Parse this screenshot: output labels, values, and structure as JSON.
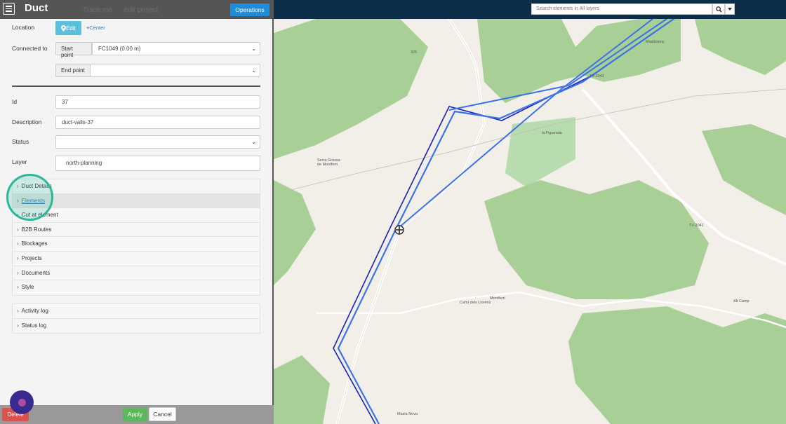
{
  "panel": {
    "title": "Duct",
    "ghost_tabs": [
      "Trace mo",
      "edit project"
    ],
    "operations_label": "Operations",
    "location_label": "Location",
    "edit_label": "Edit",
    "center_label": "Center",
    "connected_label": "Connected to",
    "start_point_label": "Start point",
    "start_point_value": "FC1049 (0.00 m)",
    "end_point_label": "End point",
    "end_point_value": "",
    "id_label": "Id",
    "id_value": "37",
    "description_label": "Description",
    "description_value": "duct-valls-37",
    "status_label": "Status",
    "status_value": "",
    "layer_label": "Layer",
    "layer_value": "north-planning",
    "sections": [
      "Duct Details",
      "Elements",
      "Cut at element",
      "B2B Routes",
      "Blockages",
      "Projects",
      "Documents",
      "Style"
    ],
    "logs": [
      "Activity log",
      "Status log"
    ],
    "delete_label": "Delete",
    "apply_label": "Apply",
    "cancel_label": "Cancel"
  },
  "search": {
    "placeholder": "Search elements in All layers"
  },
  "map": {
    "labels": [
      "Masllorenç",
      "TV-2042",
      "la Figuerola",
      "TV-2041",
      "Camí dels Lloréns",
      "Montferri",
      "Masia Nova",
      "Alt Camp",
      "Serra Grossa de Montferri",
      "325"
    ],
    "route_color": "#3a73e8",
    "route_dark_color": "#1a22b5",
    "forest_color": "#a8cf95"
  },
  "colors": {
    "header": "#555555",
    "topbar": "#0d2e49",
    "operations": "#1e8cd8",
    "apply": "#5cb85c",
    "delete": "#d9534f"
  }
}
